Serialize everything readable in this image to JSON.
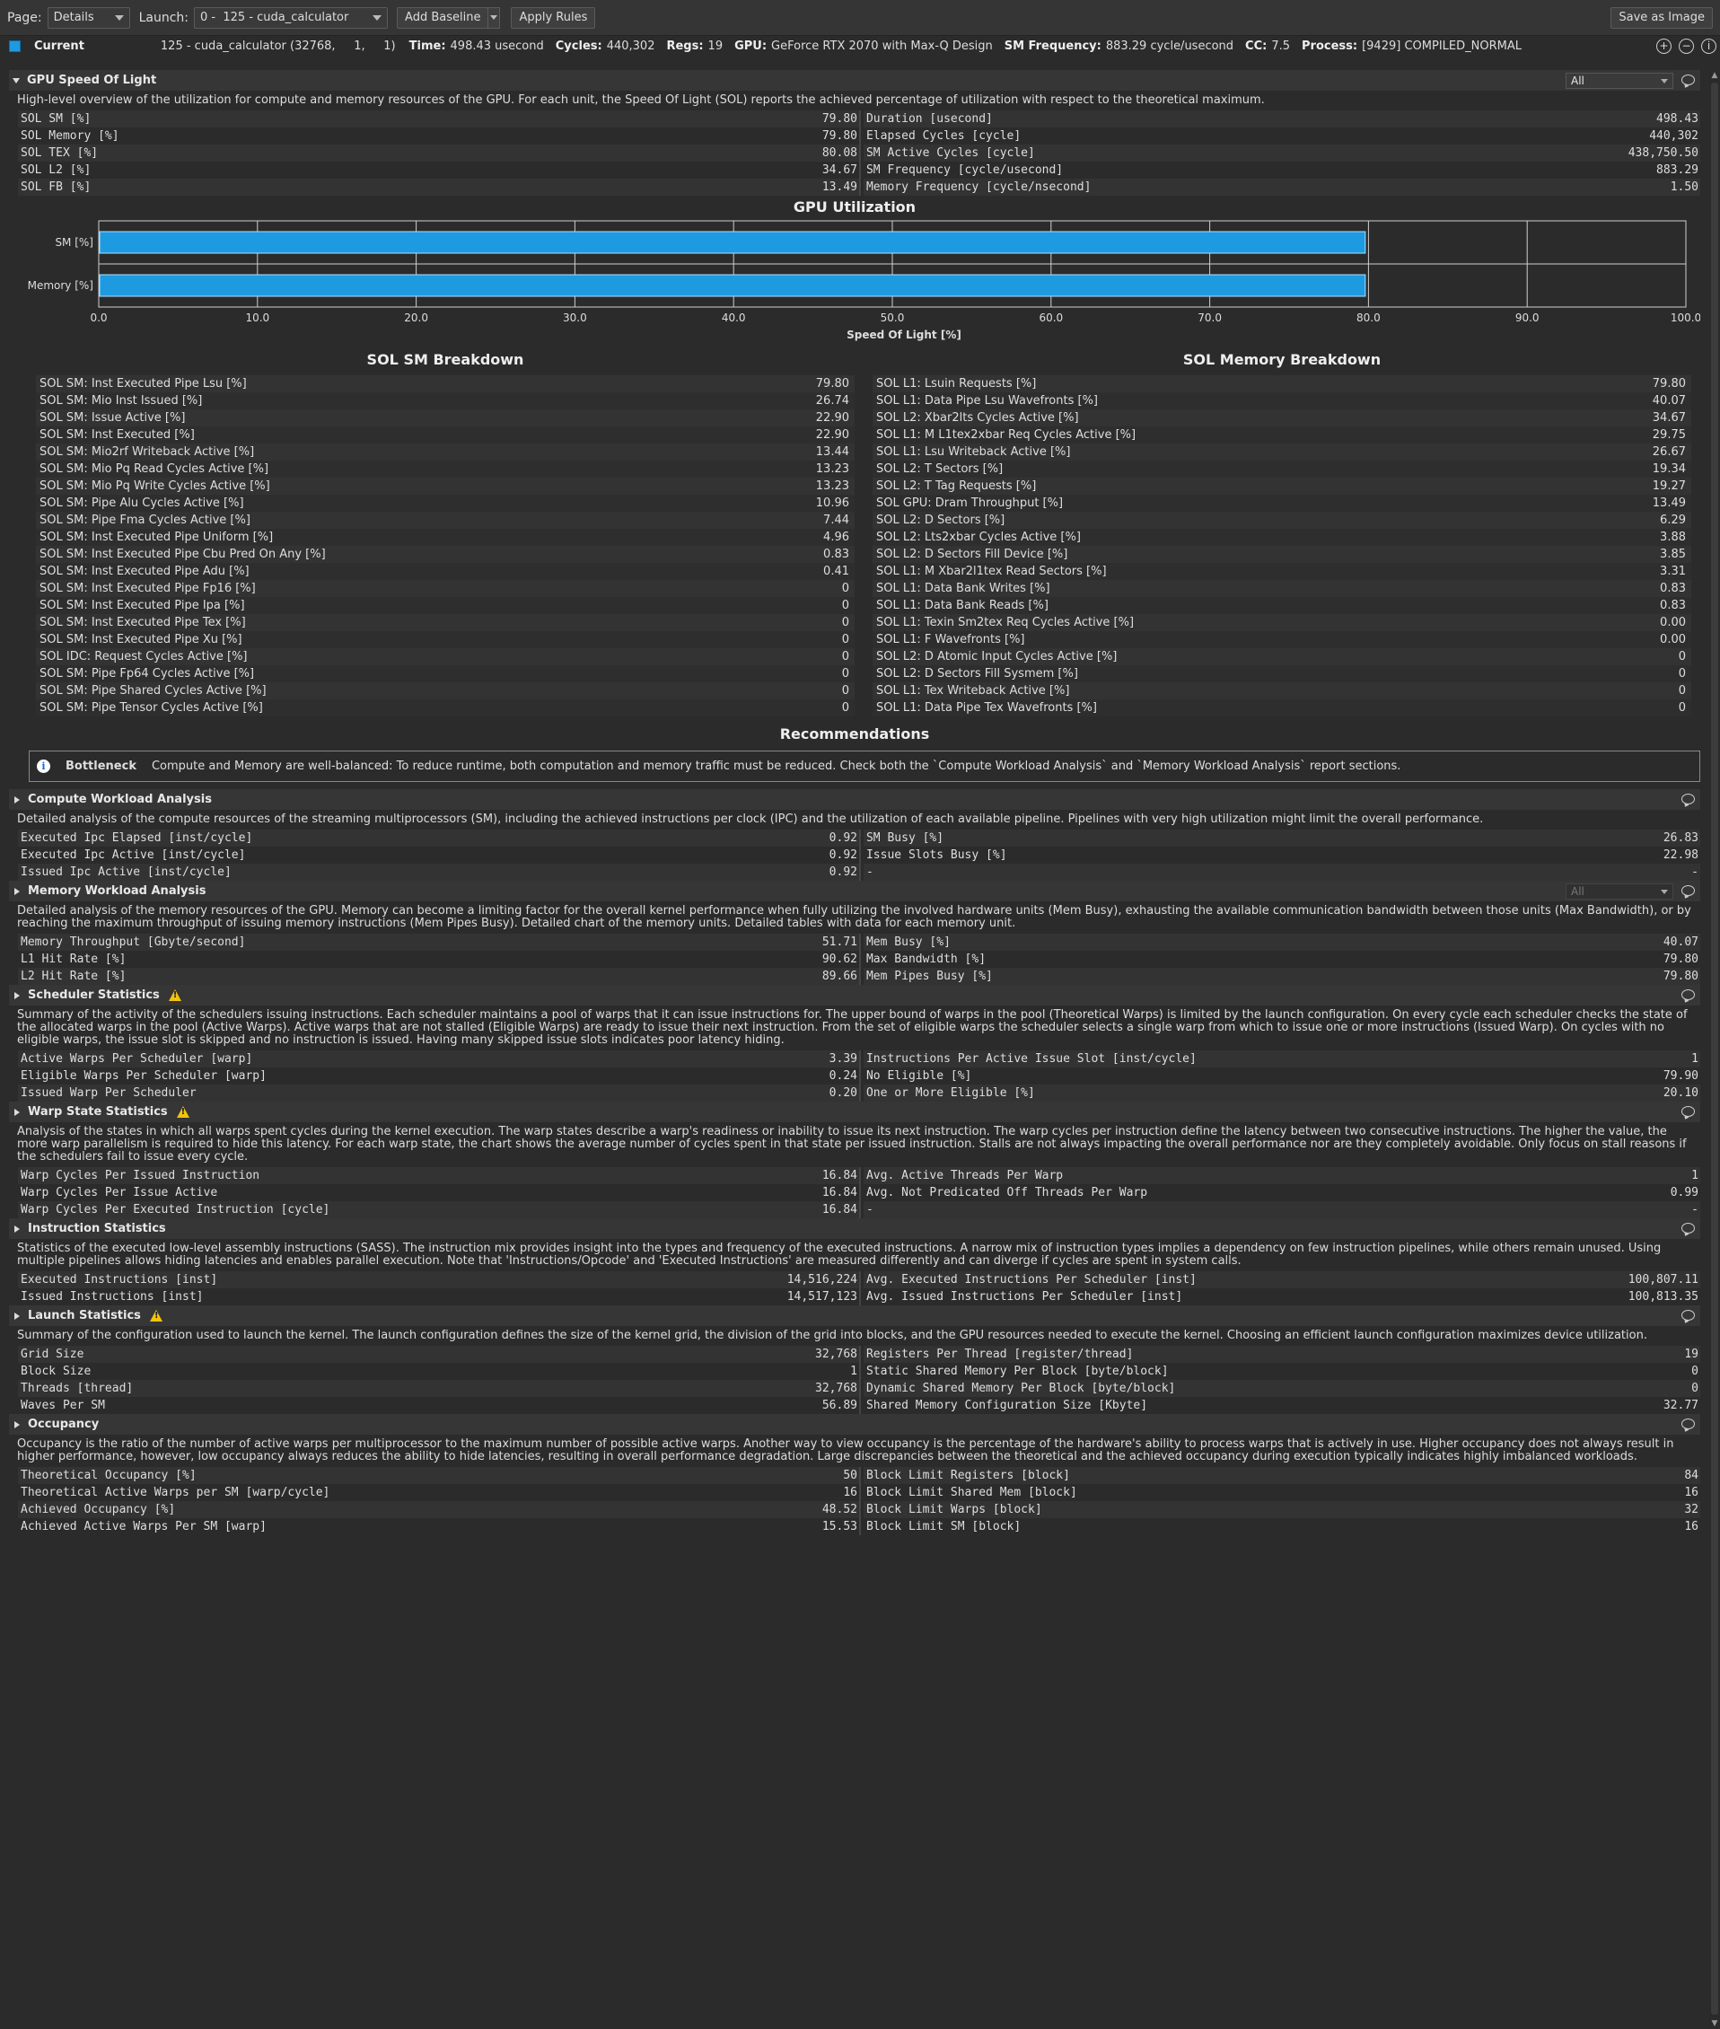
{
  "toolbar": {
    "page_label": "Page:",
    "page_value": "Details",
    "launch_label": "Launch:",
    "launch_value": "0 -  125 - cuda_calculator",
    "add_baseline": "Add Baseline",
    "apply_rules": "Apply Rules",
    "save_image": "Save as Image"
  },
  "result": {
    "name": "Current",
    "kernel": "125 - cuda_calculator (32768,     1,     1)",
    "items": [
      {
        "label": "Time:",
        "value": "498.43 usecond"
      },
      {
        "label": "Cycles:",
        "value": "440,302"
      },
      {
        "label": "Regs:",
        "value": "19"
      },
      {
        "label": "GPU:",
        "value": "GeForce RTX 2070 with Max-Q Design"
      },
      {
        "label": "SM Frequency:",
        "value": "883.29 cycle/usecond"
      },
      {
        "label": "CC:",
        "value": "7.5"
      },
      {
        "label": "Process:",
        "value": "[9429] COMPILED_NORMAL"
      }
    ]
  },
  "sol": {
    "title": "GPU Speed Of Light",
    "filter": "All",
    "desc": "High-level overview of the utilization for compute and memory resources of the GPU. For each unit, the Speed Of Light (SOL) reports the achieved percentage of utilization with respect to the theoretical maximum.",
    "left": [
      [
        "SOL SM [%]",
        "79.80"
      ],
      [
        "SOL Memory [%]",
        "79.80"
      ],
      [
        "SOL TEX [%]",
        "80.08"
      ],
      [
        "SOL L2 [%]",
        "34.67"
      ],
      [
        "SOL FB [%]",
        "13.49"
      ]
    ],
    "right": [
      [
        "Duration [usecond]",
        "498.43"
      ],
      [
        "Elapsed Cycles [cycle]",
        "440,302"
      ],
      [
        "SM Active Cycles [cycle]",
        "438,750.50"
      ],
      [
        "SM Frequency [cycle/usecond]",
        "883.29"
      ],
      [
        "Memory Frequency [cycle/nsecond]",
        "1.50"
      ]
    ]
  },
  "chart_data": {
    "type": "bar",
    "orientation": "horizontal",
    "title": "GPU Utilization",
    "categories": [
      "SM [%]",
      "Memory [%]"
    ],
    "values": [
      79.8,
      79.8
    ],
    "xlabel": "Speed Of Light [%]",
    "xlim": [
      0,
      100
    ],
    "ticks": [
      "0.0",
      "10.0",
      "20.0",
      "30.0",
      "40.0",
      "50.0",
      "60.0",
      "70.0",
      "80.0",
      "90.0",
      "100.0"
    ],
    "grid": true,
    "bar_color": "#1e9ae0"
  },
  "sm_breakdown": {
    "title": "SOL SM Breakdown",
    "rows": [
      [
        "SOL SM: Inst Executed Pipe Lsu [%]",
        "79.80"
      ],
      [
        "SOL SM: Mio Inst Issued [%]",
        "26.74"
      ],
      [
        "SOL SM: Issue Active [%]",
        "22.90"
      ],
      [
        "SOL SM: Inst Executed [%]",
        "22.90"
      ],
      [
        "SOL SM: Mio2rf Writeback Active [%]",
        "13.44"
      ],
      [
        "SOL SM: Mio Pq Read Cycles Active [%]",
        "13.23"
      ],
      [
        "SOL SM: Mio Pq Write Cycles Active [%]",
        "13.23"
      ],
      [
        "SOL SM: Pipe Alu Cycles Active [%]",
        "10.96"
      ],
      [
        "SOL SM: Pipe Fma Cycles Active [%]",
        "7.44"
      ],
      [
        "SOL SM: Inst Executed Pipe Uniform [%]",
        "4.96"
      ],
      [
        "SOL SM: Inst Executed Pipe Cbu Pred On Any [%]",
        "0.83"
      ],
      [
        "SOL SM: Inst Executed Pipe Adu [%]",
        "0.41"
      ],
      [
        "SOL SM: Inst Executed Pipe Fp16 [%]",
        "0"
      ],
      [
        "SOL SM: Inst Executed Pipe Ipa [%]",
        "0"
      ],
      [
        "SOL SM: Inst Executed Pipe Tex [%]",
        "0"
      ],
      [
        "SOL SM: Inst Executed Pipe Xu [%]",
        "0"
      ],
      [
        "SOL IDC: Request Cycles Active [%]",
        "0"
      ],
      [
        "SOL SM: Pipe Fp64 Cycles Active [%]",
        "0"
      ],
      [
        "SOL SM: Pipe Shared Cycles Active [%]",
        "0"
      ],
      [
        "SOL SM: Pipe Tensor Cycles Active [%]",
        "0"
      ]
    ]
  },
  "mem_breakdown": {
    "title": "SOL Memory Breakdown",
    "rows": [
      [
        "SOL L1: Lsuin Requests [%]",
        "79.80"
      ],
      [
        "SOL L1: Data Pipe Lsu Wavefronts [%]",
        "40.07"
      ],
      [
        "SOL L2: Xbar2lts Cycles Active [%]",
        "34.67"
      ],
      [
        "SOL L1: M L1tex2xbar Req Cycles Active [%]",
        "29.75"
      ],
      [
        "SOL L1: Lsu Writeback Active [%]",
        "26.67"
      ],
      [
        "SOL L2: T Sectors [%]",
        "19.34"
      ],
      [
        "SOL L2: T Tag Requests [%]",
        "19.27"
      ],
      [
        "SOL GPU: Dram Throughput [%]",
        "13.49"
      ],
      [
        "SOL L2: D Sectors [%]",
        "6.29"
      ],
      [
        "SOL L2: Lts2xbar Cycles Active [%]",
        "3.88"
      ],
      [
        "SOL L2: D Sectors Fill Device [%]",
        "3.85"
      ],
      [
        "SOL L1: M Xbar2l1tex Read Sectors [%]",
        "3.31"
      ],
      [
        "SOL L1: Data Bank Writes [%]",
        "0.83"
      ],
      [
        "SOL L1: Data Bank Reads [%]",
        "0.83"
      ],
      [
        "SOL L1: Texin Sm2tex Req Cycles Active [%]",
        "0.00"
      ],
      [
        "SOL L1: F Wavefronts [%]",
        "0.00"
      ],
      [
        "SOL L2: D Atomic Input Cycles Active [%]",
        "0"
      ],
      [
        "SOL L2: D Sectors Fill Sysmem [%]",
        "0"
      ],
      [
        "SOL L1: Tex Writeback Active [%]",
        "0"
      ],
      [
        "SOL L1: Data Pipe Tex Wavefronts [%]",
        "0"
      ]
    ]
  },
  "recommendations": {
    "title": "Recommendations",
    "label": "Bottleneck",
    "text": "Compute and Memory are well-balanced: To reduce runtime, both computation and memory traffic must be reduced. Check both the `Compute Workload Analysis` and `Memory Workload Analysis` report sections."
  },
  "sections": [
    {
      "id": "compute",
      "title": "Compute Workload Analysis",
      "warn": false,
      "combo": false,
      "desc": "Detailed analysis of the compute resources of the streaming multiprocessors (SM), including the achieved instructions per clock (IPC) and the utilization of each available pipeline. Pipelines with very high utilization might limit the overall performance.",
      "left": [
        [
          "Executed Ipc Elapsed [inst/cycle]",
          "0.92"
        ],
        [
          "Executed Ipc Active [inst/cycle]",
          "0.92"
        ],
        [
          "Issued Ipc Active [inst/cycle]",
          "0.92"
        ]
      ],
      "right": [
        [
          "SM Busy [%]",
          "26.83"
        ],
        [
          "Issue Slots Busy [%]",
          "22.98"
        ],
        [
          "-",
          "-"
        ]
      ]
    },
    {
      "id": "memory",
      "title": "Memory Workload Analysis",
      "warn": false,
      "combo": true,
      "desc": "Detailed analysis of the memory resources of the GPU. Memory can become a limiting factor for the overall kernel performance when fully utilizing the involved hardware units (Mem Busy), exhausting the available communication bandwidth between those units (Max Bandwidth), or by reaching the maximum throughput of issuing memory instructions (Mem Pipes Busy). Detailed chart of the memory units. Detailed tables with data for each memory unit.",
      "left": [
        [
          "Memory Throughput [Gbyte/second]",
          "51.71"
        ],
        [
          "L1 Hit Rate [%]",
          "90.62"
        ],
        [
          "L2 Hit Rate [%]",
          "89.66"
        ]
      ],
      "right": [
        [
          "Mem Busy [%]",
          "40.07"
        ],
        [
          "Max Bandwidth [%]",
          "79.80"
        ],
        [
          "Mem Pipes Busy [%]",
          "79.80"
        ]
      ]
    },
    {
      "id": "scheduler",
      "title": "Scheduler Statistics",
      "warn": true,
      "combo": false,
      "desc": "Summary of the activity of the schedulers issuing instructions. Each scheduler maintains a pool of warps that it can issue instructions for. The upper bound of warps in the pool (Theoretical Warps) is limited by the launch configuration. On every cycle each scheduler checks the state of the allocated warps in the pool (Active Warps). Active warps that are not stalled (Eligible Warps) are ready to issue their next instruction. From the set of eligible warps the scheduler selects a single warp from which to issue one or more instructions (Issued Warp). On cycles with no eligible warps, the issue slot is skipped and no instruction is issued. Having many skipped issue slots indicates poor latency hiding.",
      "left": [
        [
          "Active Warps Per Scheduler [warp]",
          "3.39"
        ],
        [
          "Eligible Warps Per Scheduler [warp]",
          "0.24"
        ],
        [
          "Issued Warp Per Scheduler",
          "0.20"
        ]
      ],
      "right": [
        [
          "Instructions Per Active Issue Slot [inst/cycle]",
          "1"
        ],
        [
          "No Eligible [%]",
          "79.90"
        ],
        [
          "One or More Eligible [%]",
          "20.10"
        ]
      ]
    },
    {
      "id": "warp",
      "title": "Warp State Statistics",
      "warn": true,
      "combo": false,
      "desc": "Analysis of the states in which all warps spent cycles during the kernel execution. The warp states describe a warp's readiness or inability to issue its next instruction. The warp cycles per instruction define the latency between two consecutive instructions. The higher the value, the more warp parallelism is required to hide this latency. For each warp state, the chart shows the average number of cycles spent in that state per issued instruction. Stalls are not always impacting the overall performance nor are they completely avoidable. Only focus on stall reasons if the schedulers fail to issue every cycle.",
      "left": [
        [
          "Warp Cycles Per Issued Instruction",
          "16.84"
        ],
        [
          "Warp Cycles Per Issue Active",
          "16.84"
        ],
        [
          "Warp Cycles Per Executed Instruction [cycle]",
          "16.84"
        ]
      ],
      "right": [
        [
          "Avg. Active Threads Per Warp",
          "1"
        ],
        [
          "Avg. Not Predicated Off Threads Per Warp",
          "0.99"
        ],
        [
          "-",
          "-"
        ]
      ]
    },
    {
      "id": "instruction",
      "title": "Instruction Statistics",
      "warn": false,
      "combo": false,
      "desc": "Statistics of the executed low-level assembly instructions (SASS). The instruction mix provides insight into the types and frequency of the executed instructions. A narrow mix of instruction types implies a dependency on few instruction pipelines, while others remain unused. Using multiple pipelines allows hiding latencies and enables parallel execution. Note that 'Instructions/Opcode' and 'Executed Instructions' are measured differently and can diverge if cycles are spent in system calls.",
      "left": [
        [
          "Executed Instructions [inst]",
          "14,516,224"
        ],
        [
          "Issued Instructions [inst]",
          "14,517,123"
        ]
      ],
      "right": [
        [
          "Avg. Executed Instructions Per Scheduler [inst]",
          "100,807.11"
        ],
        [
          "Avg. Issued Instructions Per Scheduler [inst]",
          "100,813.35"
        ]
      ]
    },
    {
      "id": "launch",
      "title": "Launch Statistics",
      "warn": true,
      "combo": false,
      "desc": "Summary of the configuration used to launch the kernel. The launch configuration defines the size of the kernel grid, the division of the grid into blocks, and the GPU resources needed to execute the kernel. Choosing an efficient launch configuration maximizes device utilization.",
      "left": [
        [
          "Grid Size",
          "32,768"
        ],
        [
          "Block Size",
          "1"
        ],
        [
          "Threads [thread]",
          "32,768"
        ],
        [
          "Waves Per SM",
          "56.89"
        ]
      ],
      "right": [
        [
          "Registers Per Thread [register/thread]",
          "19"
        ],
        [
          "Static Shared Memory Per Block [byte/block]",
          "0"
        ],
        [
          "Dynamic Shared Memory Per Block [byte/block]",
          "0"
        ],
        [
          "Shared Memory Configuration Size [Kbyte]",
          "32.77"
        ]
      ]
    },
    {
      "id": "occupancy",
      "title": "Occupancy",
      "warn": false,
      "combo": false,
      "desc": "Occupancy is the ratio of the number of active warps per multiprocessor to the maximum number of possible active warps. Another way to view occupancy is the percentage of the hardware's ability to process warps that is actively in use. Higher occupancy does not always result in higher performance, however, low occupancy always reduces the ability to hide latencies, resulting in overall performance degradation. Large discrepancies between the theoretical and the achieved occupancy during execution typically indicates highly imbalanced workloads.",
      "left": [
        [
          "Theoretical Occupancy [%]",
          "50"
        ],
        [
          "Theoretical Active Warps per SM [warp/cycle]",
          "16"
        ],
        [
          "Achieved Occupancy [%]",
          "48.52"
        ],
        [
          "Achieved Active Warps Per SM [warp]",
          "15.53"
        ]
      ],
      "right": [
        [
          "Block Limit Registers [block]",
          "84"
        ],
        [
          "Block Limit Shared Mem [block]",
          "16"
        ],
        [
          "Block Limit Warps [block]",
          "32"
        ],
        [
          "Block Limit SM [block]",
          "16"
        ]
      ]
    }
  ]
}
